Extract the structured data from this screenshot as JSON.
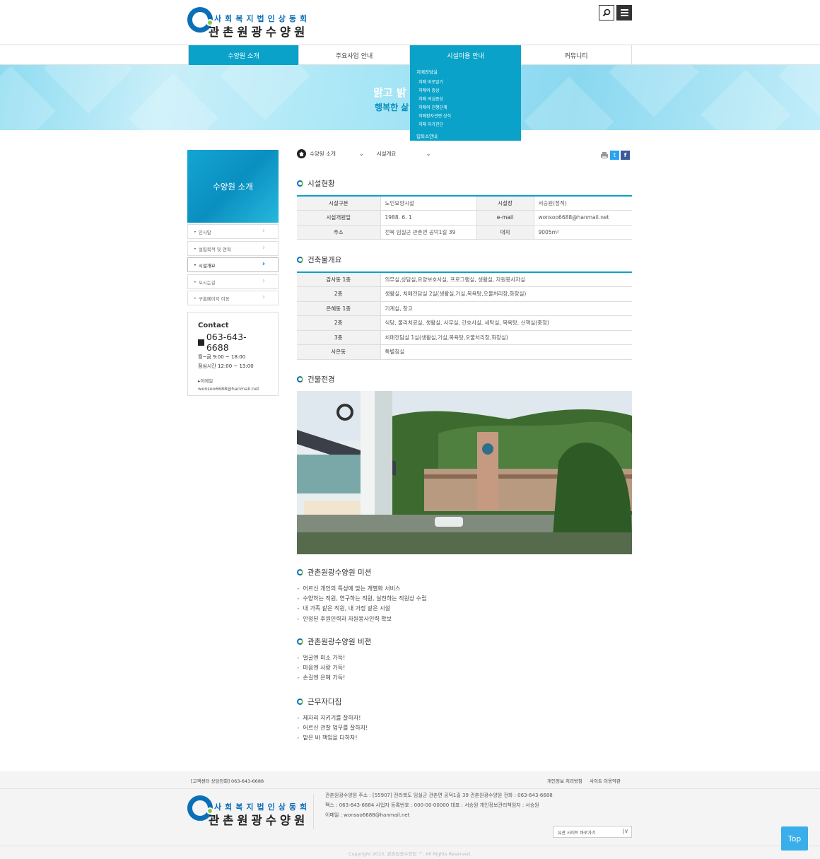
{
  "header": {
    "logo_line1": "사회복지법인상동회",
    "logo_line2": "관촌원광수양원",
    "search_icon": "search-icon",
    "menu_icon": "menu-icon"
  },
  "gnb": [
    "수양원 소개",
    "주요사업 안내",
    "시설이용 안내",
    "커뮤니티"
  ],
  "dropdown": {
    "head": "치매전담실",
    "items": [
      "치매 바로알기",
      "치매의 증상",
      "치매 의심증상",
      "치매의 진행단계",
      "치매환자관련 상식",
      "치매 자가진단"
    ],
    "tail": "입퇴소안내"
  },
  "visual": {
    "line1": "맑고 밝",
    "line2": "행복한 삶"
  },
  "lnb": {
    "title": "수양원 소개",
    "items": [
      "인사말",
      "설립목적 및 연혁",
      "시설개요",
      "오시는길",
      "구홈페이지 이동"
    ],
    "active": 2
  },
  "contact": {
    "title": "Contact",
    "phone": "063-643-6688",
    "hours": "월~금 9:00 ~ 18:00",
    "lunch": "점심시간 12:00 ~ 13:00",
    "email_label": "이메일",
    "email": "wonsoo6688@hanmail.net"
  },
  "location": {
    "depth1": "수양원 소개",
    "depth2": "시설개요"
  },
  "sections": {
    "status": "시설현황",
    "building": "건축물개요",
    "photo": "건물전경",
    "mission": "관촌원광수양원 미션",
    "vision": "관촌원광수양원 비젼",
    "pledge": "근무자다짐"
  },
  "status_table": [
    [
      "시설구분",
      "노인요양시설",
      "시설장",
      "서승원(정직)"
    ],
    [
      "시설개원일",
      "1988. 6. 1",
      "e-mail",
      "wonsoo6688@hanmail.net"
    ],
    [
      "주소",
      "전북 임실군 관촌면 공덕1길 39",
      "대지",
      "9005m²"
    ]
  ],
  "building_table": [
    [
      "감사동 1층",
      "의무실,상담실,요양보호사실, 프로그램실, 생활실, 자원봉사자실"
    ],
    [
      "2층",
      "생활실, 치매전담실 2실(생활실,거실,목욕탕,오물처리장,화장실)"
    ],
    [
      "은혜동 1층",
      "기계실, 창고"
    ],
    [
      "2층",
      "식당, 물리치료실, 생활실, 사무실, 간호사실, 세탁실, 목욕탕, 산책실(중정)"
    ],
    [
      "3층",
      "치매전담실 1실(생활실,거실,목욕탕,오물처리장,화장실)"
    ],
    [
      "사은동",
      "특별침실"
    ]
  ],
  "mission_list": [
    "어르신 개인의 특성에 맞는 개별화 서비스",
    "수양하는 직원, 연구하는 직원, 실천하는 직원상 수립",
    "내 가족 같은 직원, 내 가정 같은 시설",
    "안정된 후원인력과 자원봉사인력 확보"
  ],
  "vision_list": [
    "얼굴엔 미소 가득!",
    "마음엔 사랑 가득!",
    "손길엔 은혜 가득!"
  ],
  "pledge_list": [
    "제자리 지키기를 잘하자!",
    "어르신 관찰 업무를 잘하자!",
    "맡은 바 책임을 다하자!"
  ],
  "footer": {
    "cs": "[고객센터 상담전화] 063-643-6688",
    "privacy": "개인정보 처리방침",
    "terms": "사이트 이용약관",
    "info1": "관촌원광수양원    주소 : [55907] 전라북도 임실군 관촌면 공덕1길 39 관촌원광수양원    전화 : 063-643-6688",
    "info2": "팩스 : 063-643-6684    사업자 등록번호 : 000-00-00000    대표 : 서승원    개인정보관리책임자 : 서승원",
    "info3": "이메일 : wonsoo6688@hanmail.net",
    "family_site": "유관 사이트 바로가기",
    "copyright": "Copyright 2023, 관촌원광수양원 ™. All Rights Reserved.",
    "top": "Top"
  },
  "colors": {
    "accent": "#0aa2c8",
    "brand": "#0b6fb8"
  }
}
